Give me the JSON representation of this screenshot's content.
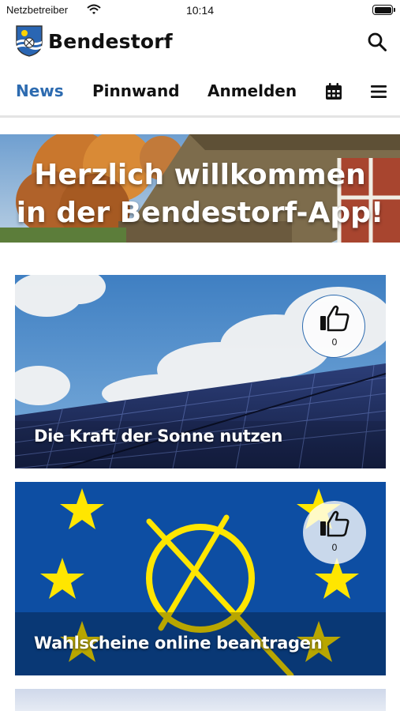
{
  "status_bar": {
    "carrier": "Netzbetreiber",
    "time": "10:14"
  },
  "header": {
    "app_name": "Bendestorf"
  },
  "nav": {
    "tabs": [
      "News",
      "Pinnwand",
      "Anmelden"
    ],
    "active": "News"
  },
  "hero": {
    "line1": "Herzlich willkommen",
    "line2": "in der Bendestorf-App!"
  },
  "articles": [
    {
      "title": "Die Kraft der Sonne nutzen",
      "likes": "0"
    },
    {
      "title": "Wahlscheine online beantragen",
      "likes": "0"
    }
  ],
  "colors": {
    "accent": "#2d6bb0",
    "eu_blue": "#0d4ea3",
    "eu_yellow": "#ffe600"
  },
  "icons": [
    "wifi-icon",
    "battery-icon",
    "search-icon",
    "calendar-icon",
    "menu-icon",
    "thumbs-up-icon"
  ]
}
